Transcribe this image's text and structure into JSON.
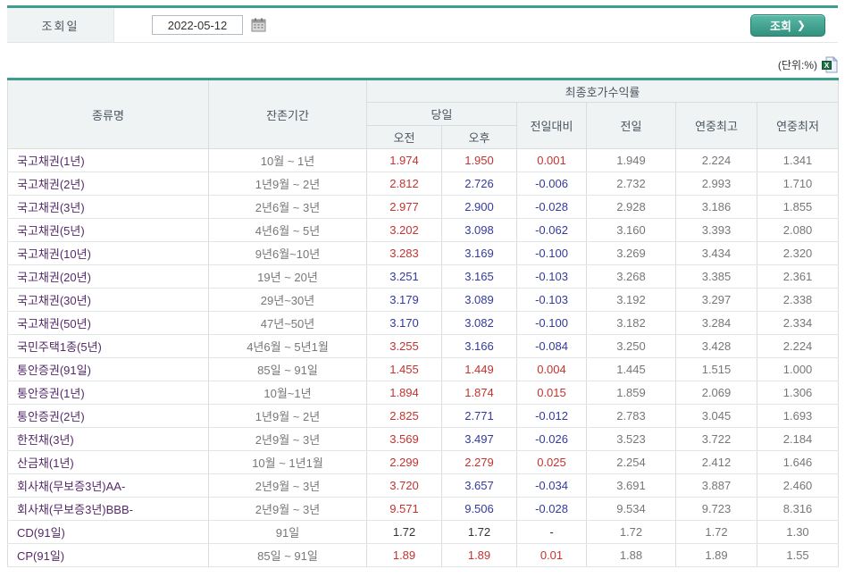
{
  "colors": {
    "accent_teal": "#3e9d8c",
    "up_red": "#c33330",
    "down_blue": "#333a9d",
    "flat_black": "#333333",
    "bond_name_purple": "#542a68",
    "header_bg": "#f0f3f3"
  },
  "search": {
    "label": "조회일",
    "date_value": "2022-05-12",
    "button_label": "조회",
    "button_arrow": "❯"
  },
  "unit_label": "(단위:%)",
  "table": {
    "headers": {
      "name": "종류명",
      "term": "잔존기간",
      "yield_group": "최종호가수익률",
      "today": "당일",
      "am": "오전",
      "pm": "오후",
      "diff": "전일대비",
      "prev": "전일",
      "year_high": "연중최고",
      "year_low": "연중최저"
    },
    "rows": [
      {
        "name": "국고채권(1년)",
        "term": "10월 ~ 1년",
        "am": {
          "v": "1.974",
          "c": "up"
        },
        "pm": {
          "v": "1.950",
          "c": "up"
        },
        "diff": {
          "v": "0.001",
          "c": "up"
        },
        "prev": "1.949",
        "high": "2.224",
        "low": "1.341",
        "group": false
      },
      {
        "name": "국고채권(2년)",
        "term": "1년9월 ~ 2년",
        "am": {
          "v": "2.812",
          "c": "up"
        },
        "pm": {
          "v": "2.726",
          "c": "down"
        },
        "diff": {
          "v": "-0.006",
          "c": "down"
        },
        "prev": "2.732",
        "high": "2.993",
        "low": "1.710",
        "group": false
      },
      {
        "name": "국고채권(3년)",
        "term": "2년6월 ~ 3년",
        "am": {
          "v": "2.977",
          "c": "up"
        },
        "pm": {
          "v": "2.900",
          "c": "down"
        },
        "diff": {
          "v": "-0.028",
          "c": "down"
        },
        "prev": "2.928",
        "high": "3.186",
        "low": "1.855",
        "group": false
      },
      {
        "name": "국고채권(5년)",
        "term": "4년6월 ~ 5년",
        "am": {
          "v": "3.202",
          "c": "up"
        },
        "pm": {
          "v": "3.098",
          "c": "down"
        },
        "diff": {
          "v": "-0.062",
          "c": "down"
        },
        "prev": "3.160",
        "high": "3.393",
        "low": "2.080",
        "group": false
      },
      {
        "name": "국고채권(10년)",
        "term": "9년6월~10년",
        "am": {
          "v": "3.283",
          "c": "up"
        },
        "pm": {
          "v": "3.169",
          "c": "down"
        },
        "diff": {
          "v": "-0.100",
          "c": "down"
        },
        "prev": "3.269",
        "high": "3.434",
        "low": "2.320",
        "group": true
      },
      {
        "name": "국고채권(20년)",
        "term": "19년 ~ 20년",
        "am": {
          "v": "3.251",
          "c": "down"
        },
        "pm": {
          "v": "3.165",
          "c": "down"
        },
        "diff": {
          "v": "-0.103",
          "c": "down"
        },
        "prev": "3.268",
        "high": "3.385",
        "low": "2.361",
        "group": false
      },
      {
        "name": "국고채권(30년)",
        "term": "29년~30년",
        "am": {
          "v": "3.179",
          "c": "down"
        },
        "pm": {
          "v": "3.089",
          "c": "down"
        },
        "diff": {
          "v": "-0.103",
          "c": "down"
        },
        "prev": "3.192",
        "high": "3.297",
        "low": "2.338",
        "group": false
      },
      {
        "name": "국고채권(50년)",
        "term": "47년~50년",
        "am": {
          "v": "3.170",
          "c": "down"
        },
        "pm": {
          "v": "3.082",
          "c": "down"
        },
        "diff": {
          "v": "-0.100",
          "c": "down"
        },
        "prev": "3.182",
        "high": "3.284",
        "low": "2.334",
        "group": false
      },
      {
        "name": "국민주택1종(5년)",
        "term": "4년6월 ~ 5년1월",
        "am": {
          "v": "3.255",
          "c": "up"
        },
        "pm": {
          "v": "3.166",
          "c": "down"
        },
        "diff": {
          "v": "-0.084",
          "c": "down"
        },
        "prev": "3.250",
        "high": "3.428",
        "low": "2.224",
        "group": true
      },
      {
        "name": "통안증권(91일)",
        "term": "85일 ~ 91일",
        "am": {
          "v": "1.455",
          "c": "up"
        },
        "pm": {
          "v": "1.449",
          "c": "up"
        },
        "diff": {
          "v": "0.004",
          "c": "up"
        },
        "prev": "1.445",
        "high": "1.515",
        "low": "1.000",
        "group": true
      },
      {
        "name": "통안증권(1년)",
        "term": "10월~1년",
        "am": {
          "v": "1.894",
          "c": "up"
        },
        "pm": {
          "v": "1.874",
          "c": "up"
        },
        "diff": {
          "v": "0.015",
          "c": "up"
        },
        "prev": "1.859",
        "high": "2.069",
        "low": "1.306",
        "group": false
      },
      {
        "name": "통안증권(2년)",
        "term": "1년9월 ~ 2년",
        "am": {
          "v": "2.825",
          "c": "up"
        },
        "pm": {
          "v": "2.771",
          "c": "down"
        },
        "diff": {
          "v": "-0.012",
          "c": "down"
        },
        "prev": "2.783",
        "high": "3.045",
        "low": "1.693",
        "group": false
      },
      {
        "name": "한전채(3년)",
        "term": "2년9월 ~ 3년",
        "am": {
          "v": "3.569",
          "c": "up"
        },
        "pm": {
          "v": "3.497",
          "c": "down"
        },
        "diff": {
          "v": "-0.026",
          "c": "down"
        },
        "prev": "3.523",
        "high": "3.722",
        "low": "2.184",
        "group": true
      },
      {
        "name": "산금채(1년)",
        "term": "10월 ~ 1년1월",
        "am": {
          "v": "2.299",
          "c": "up"
        },
        "pm": {
          "v": "2.279",
          "c": "up"
        },
        "diff": {
          "v": "0.025",
          "c": "up"
        },
        "prev": "2.254",
        "high": "2.412",
        "low": "1.646",
        "group": true
      },
      {
        "name": "회사채(무보증3년)AA-",
        "term": "2년9월 ~ 3년",
        "am": {
          "v": "3.720",
          "c": "up"
        },
        "pm": {
          "v": "3.657",
          "c": "down"
        },
        "diff": {
          "v": "-0.034",
          "c": "down"
        },
        "prev": "3.691",
        "high": "3.887",
        "low": "2.460",
        "group": true
      },
      {
        "name": "회사채(무보증3년)BBB-",
        "term": "2년9월 ~ 3년",
        "am": {
          "v": "9.571",
          "c": "up"
        },
        "pm": {
          "v": "9.506",
          "c": "down"
        },
        "diff": {
          "v": "-0.028",
          "c": "down"
        },
        "prev": "9.534",
        "high": "9.723",
        "low": "8.316",
        "group": false
      },
      {
        "name": "CD(91일)",
        "term": "91일",
        "am": {
          "v": "1.72",
          "c": "flat"
        },
        "pm": {
          "v": "1.72",
          "c": "flat"
        },
        "diff": {
          "v": "-",
          "c": "flat"
        },
        "prev": "1.72",
        "high": "1.72",
        "low": "1.30",
        "group": true
      },
      {
        "name": "CP(91일)",
        "term": "85일 ~ 91일",
        "am": {
          "v": "1.89",
          "c": "up"
        },
        "pm": {
          "v": "1.89",
          "c": "up"
        },
        "diff": {
          "v": "0.01",
          "c": "up"
        },
        "prev": "1.88",
        "high": "1.89",
        "low": "1.55",
        "group": true
      }
    ]
  }
}
